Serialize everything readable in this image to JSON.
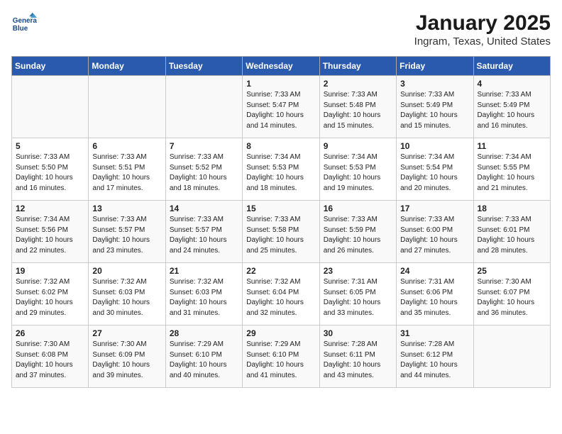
{
  "header": {
    "logo_line1": "General",
    "logo_line2": "Blue",
    "title": "January 2025",
    "subtitle": "Ingram, Texas, United States"
  },
  "days_of_week": [
    "Sunday",
    "Monday",
    "Tuesday",
    "Wednesday",
    "Thursday",
    "Friday",
    "Saturday"
  ],
  "weeks": [
    [
      {
        "day": "",
        "info": ""
      },
      {
        "day": "",
        "info": ""
      },
      {
        "day": "",
        "info": ""
      },
      {
        "day": "1",
        "info": "Sunrise: 7:33 AM\nSunset: 5:47 PM\nDaylight: 10 hours\nand 14 minutes."
      },
      {
        "day": "2",
        "info": "Sunrise: 7:33 AM\nSunset: 5:48 PM\nDaylight: 10 hours\nand 15 minutes."
      },
      {
        "day": "3",
        "info": "Sunrise: 7:33 AM\nSunset: 5:49 PM\nDaylight: 10 hours\nand 15 minutes."
      },
      {
        "day": "4",
        "info": "Sunrise: 7:33 AM\nSunset: 5:49 PM\nDaylight: 10 hours\nand 16 minutes."
      }
    ],
    [
      {
        "day": "5",
        "info": "Sunrise: 7:33 AM\nSunset: 5:50 PM\nDaylight: 10 hours\nand 16 minutes."
      },
      {
        "day": "6",
        "info": "Sunrise: 7:33 AM\nSunset: 5:51 PM\nDaylight: 10 hours\nand 17 minutes."
      },
      {
        "day": "7",
        "info": "Sunrise: 7:33 AM\nSunset: 5:52 PM\nDaylight: 10 hours\nand 18 minutes."
      },
      {
        "day": "8",
        "info": "Sunrise: 7:34 AM\nSunset: 5:53 PM\nDaylight: 10 hours\nand 18 minutes."
      },
      {
        "day": "9",
        "info": "Sunrise: 7:34 AM\nSunset: 5:53 PM\nDaylight: 10 hours\nand 19 minutes."
      },
      {
        "day": "10",
        "info": "Sunrise: 7:34 AM\nSunset: 5:54 PM\nDaylight: 10 hours\nand 20 minutes."
      },
      {
        "day": "11",
        "info": "Sunrise: 7:34 AM\nSunset: 5:55 PM\nDaylight: 10 hours\nand 21 minutes."
      }
    ],
    [
      {
        "day": "12",
        "info": "Sunrise: 7:34 AM\nSunset: 5:56 PM\nDaylight: 10 hours\nand 22 minutes."
      },
      {
        "day": "13",
        "info": "Sunrise: 7:33 AM\nSunset: 5:57 PM\nDaylight: 10 hours\nand 23 minutes."
      },
      {
        "day": "14",
        "info": "Sunrise: 7:33 AM\nSunset: 5:57 PM\nDaylight: 10 hours\nand 24 minutes."
      },
      {
        "day": "15",
        "info": "Sunrise: 7:33 AM\nSunset: 5:58 PM\nDaylight: 10 hours\nand 25 minutes."
      },
      {
        "day": "16",
        "info": "Sunrise: 7:33 AM\nSunset: 5:59 PM\nDaylight: 10 hours\nand 26 minutes."
      },
      {
        "day": "17",
        "info": "Sunrise: 7:33 AM\nSunset: 6:00 PM\nDaylight: 10 hours\nand 27 minutes."
      },
      {
        "day": "18",
        "info": "Sunrise: 7:33 AM\nSunset: 6:01 PM\nDaylight: 10 hours\nand 28 minutes."
      }
    ],
    [
      {
        "day": "19",
        "info": "Sunrise: 7:32 AM\nSunset: 6:02 PM\nDaylight: 10 hours\nand 29 minutes."
      },
      {
        "day": "20",
        "info": "Sunrise: 7:32 AM\nSunset: 6:03 PM\nDaylight: 10 hours\nand 30 minutes."
      },
      {
        "day": "21",
        "info": "Sunrise: 7:32 AM\nSunset: 6:03 PM\nDaylight: 10 hours\nand 31 minutes."
      },
      {
        "day": "22",
        "info": "Sunrise: 7:32 AM\nSunset: 6:04 PM\nDaylight: 10 hours\nand 32 minutes."
      },
      {
        "day": "23",
        "info": "Sunrise: 7:31 AM\nSunset: 6:05 PM\nDaylight: 10 hours\nand 33 minutes."
      },
      {
        "day": "24",
        "info": "Sunrise: 7:31 AM\nSunset: 6:06 PM\nDaylight: 10 hours\nand 35 minutes."
      },
      {
        "day": "25",
        "info": "Sunrise: 7:30 AM\nSunset: 6:07 PM\nDaylight: 10 hours\nand 36 minutes."
      }
    ],
    [
      {
        "day": "26",
        "info": "Sunrise: 7:30 AM\nSunset: 6:08 PM\nDaylight: 10 hours\nand 37 minutes."
      },
      {
        "day": "27",
        "info": "Sunrise: 7:30 AM\nSunset: 6:09 PM\nDaylight: 10 hours\nand 39 minutes."
      },
      {
        "day": "28",
        "info": "Sunrise: 7:29 AM\nSunset: 6:10 PM\nDaylight: 10 hours\nand 40 minutes."
      },
      {
        "day": "29",
        "info": "Sunrise: 7:29 AM\nSunset: 6:10 PM\nDaylight: 10 hours\nand 41 minutes."
      },
      {
        "day": "30",
        "info": "Sunrise: 7:28 AM\nSunset: 6:11 PM\nDaylight: 10 hours\nand 43 minutes."
      },
      {
        "day": "31",
        "info": "Sunrise: 7:28 AM\nSunset: 6:12 PM\nDaylight: 10 hours\nand 44 minutes."
      },
      {
        "day": "",
        "info": ""
      }
    ]
  ]
}
